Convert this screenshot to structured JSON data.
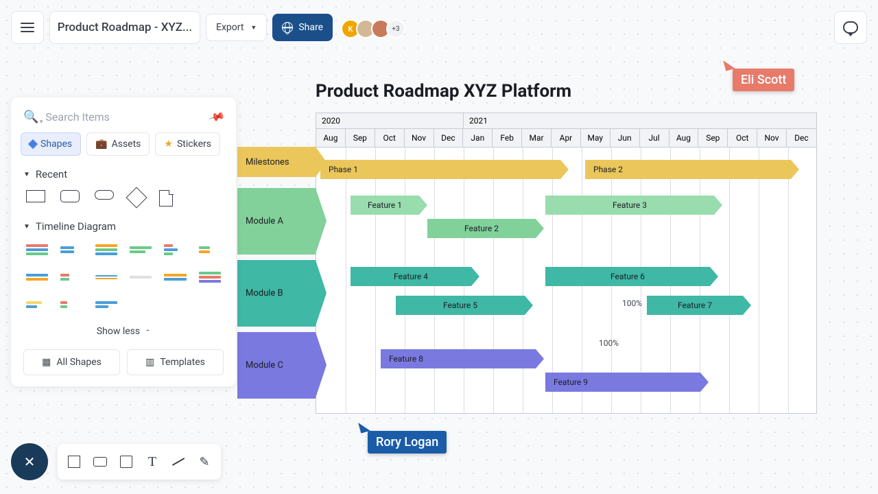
{
  "header": {
    "title": "Product Roadmap - XYZ...",
    "export_label": "Export",
    "share_label": "Share",
    "avatar_extra": "+3"
  },
  "sidebar": {
    "search_placeholder": "Search Items",
    "tabs": {
      "shapes": "Shapes",
      "assets": "Assets",
      "stickers": "Stickers"
    },
    "recent_label": "Recent",
    "timeline_label": "Timeline Diagram",
    "show_less": "Show less",
    "all_shapes": "All Shapes",
    "templates": "Templates"
  },
  "chart": {
    "title": "Product Roadmap XYZ Platform",
    "years": [
      "2020",
      "2021"
    ],
    "months": [
      "Aug",
      "Sep",
      "Oct",
      "Nov",
      "Dec",
      "Jan",
      "Feb",
      "Mar",
      "Apr",
      "May",
      "Jun",
      "Jul",
      "Aug",
      "Sep",
      "Oct",
      "Nov",
      "Dec"
    ],
    "rows": {
      "milestones": "Milestones",
      "moduleA": "Module A",
      "moduleB": "Module B",
      "moduleC": "Module C"
    },
    "bars": {
      "phase1": "Phase 1",
      "phase2": "Phase 2",
      "f1": "Feature 1",
      "f2": "Feature 2",
      "f3": "Feature 3",
      "f4": "Feature 4",
      "f5": "Feature 5",
      "f6": "Feature 6",
      "f7": "Feature 7",
      "f8": "Feature 8",
      "f9": "Feature 9"
    },
    "pct1": "100%",
    "pct2": "100%"
  },
  "cursors": {
    "eli": "Eli Scott",
    "rory": "Rory Logan"
  },
  "chart_data": {
    "type": "table",
    "title": "Product Roadmap XYZ Platform",
    "x_axis": {
      "start": "2020-08",
      "end": "2021-12",
      "months": [
        "Aug",
        "Sep",
        "Oct",
        "Nov",
        "Dec",
        "Jan",
        "Feb",
        "Mar",
        "Apr",
        "May",
        "Jun",
        "Jul",
        "Aug",
        "Sep",
        "Oct",
        "Nov",
        "Dec"
      ]
    },
    "groups": [
      {
        "name": "Milestones",
        "color": "#ebc65a",
        "items": [
          {
            "label": "Phase 1",
            "start": "2020-08",
            "end": "2021-04"
          },
          {
            "label": "Phase 2",
            "start": "2021-05",
            "end": "2021-12"
          }
        ]
      },
      {
        "name": "Module A",
        "color": "#82d09a",
        "items": [
          {
            "label": "Feature 1",
            "start": "2020-09",
            "end": "2020-11"
          },
          {
            "label": "Feature 2",
            "start": "2020-12",
            "end": "2021-03"
          },
          {
            "label": "Feature 3",
            "start": "2021-04",
            "end": "2021-09"
          }
        ]
      },
      {
        "name": "Module B",
        "color": "#3fb8a5",
        "items": [
          {
            "label": "Feature 4",
            "start": "2020-09",
            "end": "2021-01"
          },
          {
            "label": "Feature 5",
            "start": "2020-11",
            "end": "2021-03"
          },
          {
            "label": "Feature 6",
            "start": "2021-04",
            "end": "2021-09"
          },
          {
            "label": "Feature 7",
            "start": "2021-07",
            "end": "2021-10",
            "progress": "100%"
          }
        ]
      },
      {
        "name": "Module C",
        "color": "#7a79e0",
        "items": [
          {
            "label": "Feature 8",
            "start": "2020-10",
            "end": "2021-03",
            "progress": "100%"
          },
          {
            "label": "Feature 9",
            "start": "2021-04",
            "end": "2021-09"
          }
        ]
      }
    ]
  }
}
